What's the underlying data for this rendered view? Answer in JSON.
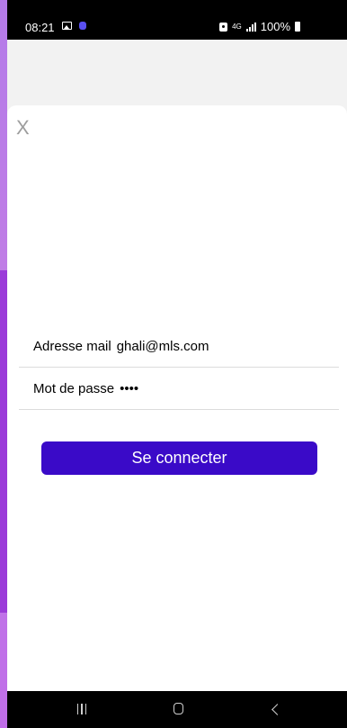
{
  "status_bar": {
    "time": "08:21",
    "network": "4G",
    "battery": "100%"
  },
  "icons": {
    "gallery": "gallery-icon",
    "app": "app-notification-icon",
    "lock": "lock-icon",
    "signal": "signal-icon",
    "battery": "battery-icon",
    "recent": "recent-apps-icon",
    "home": "home-icon",
    "back": "back-icon"
  },
  "sheet": {
    "close_label": "X"
  },
  "form": {
    "email_label": "Adresse mail",
    "email_value": "ghali@mls.com",
    "password_label": "Mot de passe",
    "password_value": "••••",
    "submit_label": "Se connecter"
  },
  "colors": {
    "primary_button": "#3a0ac8",
    "background_accent": "#b47be8"
  }
}
